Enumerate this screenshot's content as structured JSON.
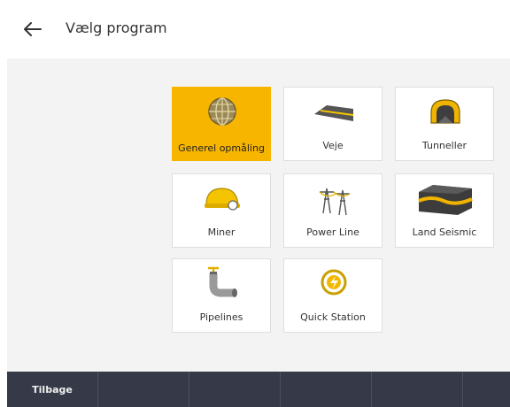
{
  "header": {
    "title": "Vælg program",
    "back_icon": "arrow-left-icon"
  },
  "accent_color": "#f7b500",
  "programs": [
    {
      "label": "Generel opmåling",
      "icon": "globe-survey-icon",
      "selected": true
    },
    {
      "label": "Veje",
      "icon": "road-icon",
      "selected": false
    },
    {
      "label": "Tunneller",
      "icon": "tunnel-icon",
      "selected": false
    },
    {
      "label": "Miner",
      "icon": "mining-helmet-icon",
      "selected": false
    },
    {
      "label": "Power Line",
      "icon": "power-line-icon",
      "selected": false
    },
    {
      "label": "Land Seismic",
      "icon": "land-seismic-icon",
      "selected": false
    },
    {
      "label": "Pipelines",
      "icon": "pipeline-icon",
      "selected": false
    },
    {
      "label": "Quick Station",
      "icon": "quick-station-icon",
      "selected": false
    }
  ],
  "footer": {
    "buttons": [
      "Tilbage",
      "",
      "",
      "",
      "",
      ""
    ]
  }
}
